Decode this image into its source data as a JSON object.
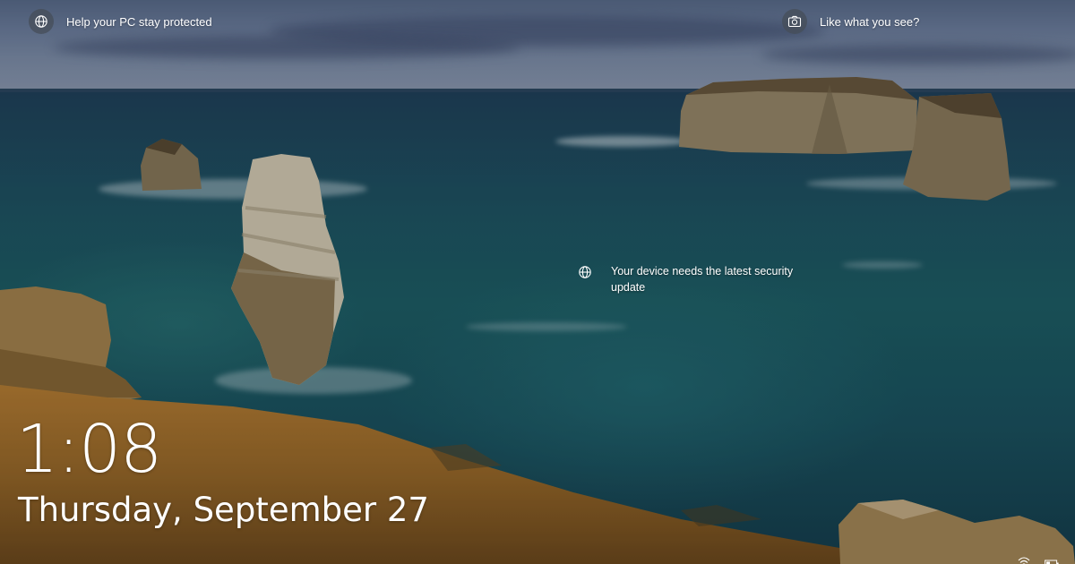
{
  "notifications": {
    "top_left": {
      "icon": "globe-icon",
      "label": "Help your PC stay protected"
    },
    "top_right": {
      "icon": "camera-icon",
      "label": "Like what you see?"
    },
    "center": {
      "icon": "globe-icon",
      "label": "Your device needs the latest security update"
    }
  },
  "clock": {
    "time": "1:08",
    "date": "Thursday, September 27"
  },
  "status_tray": {
    "icons": [
      "wifi-icon",
      "battery-icon"
    ]
  },
  "colors": {
    "text": "#ffffff",
    "icon_badge": "#464e58",
    "sea": "#1e6068",
    "sky": "#6d7fa0",
    "cliff": "#a8722a"
  }
}
